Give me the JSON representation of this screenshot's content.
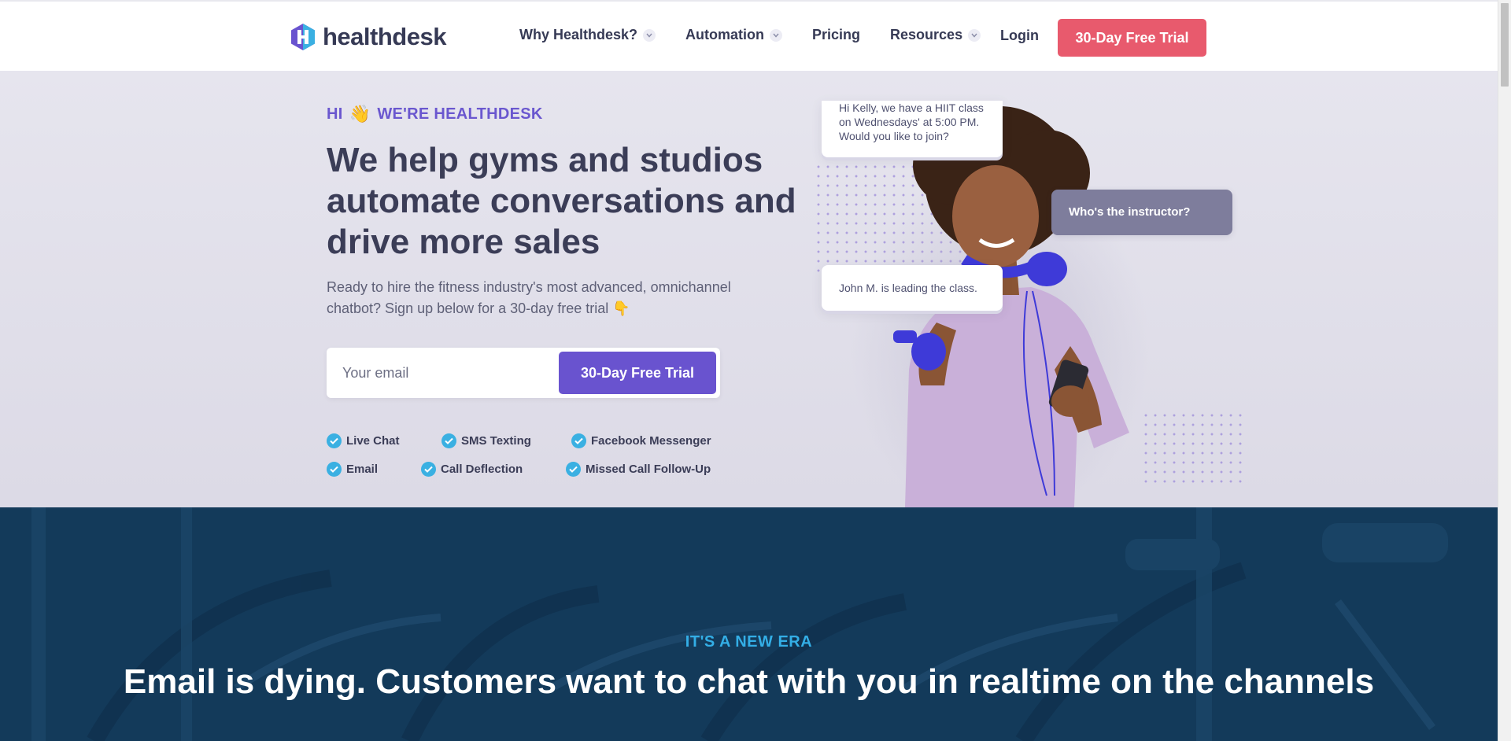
{
  "header": {
    "logo_text": "healthdesk",
    "nav": [
      {
        "label": "Why Healthdesk?",
        "has_dropdown": true
      },
      {
        "label": "Automation",
        "has_dropdown": true
      },
      {
        "label": "Pricing",
        "has_dropdown": false
      },
      {
        "label": "Resources",
        "has_dropdown": true
      }
    ],
    "login_label": "Login",
    "cta_label": "30-Day Free Trial"
  },
  "hero": {
    "eyebrow_hi": "HI",
    "eyebrow_rest": "WE'RE HEALTHDESK",
    "wave_glyph": "👋",
    "title": "We help gyms and studios automate conversations and drive more sales",
    "subtitle": "Ready to hire the fitness industry's most advanced, omnichannel chatbot? Sign up below for a 30-day free trial 👇",
    "email_placeholder": "Your email",
    "form_cta_label": "30-Day Free Trial",
    "features": [
      [
        "Live Chat",
        "SMS Texting",
        "Facebook Messenger"
      ],
      [
        "Email",
        "Call Deflection",
        "Missed Call Follow-Up"
      ]
    ],
    "chat": {
      "bot_message_1": "Hi Kelly, we have a HIIT class on Wednesdays' at 5:00 PM. Would you like to join?",
      "user_message": "Who's the instructor?",
      "bot_message_2": "John M. is leading the class."
    }
  },
  "era": {
    "eyebrow": "IT'S A NEW ERA",
    "title": "Email is dying. Customers want to chat with you in realtime on the channels"
  },
  "colors": {
    "brand_purple": "#6953cf",
    "cta_red": "#e85a6d",
    "navy": "#133a5a",
    "check_blue": "#3ab0e2",
    "eyebrow_blue": "#33aee6"
  }
}
